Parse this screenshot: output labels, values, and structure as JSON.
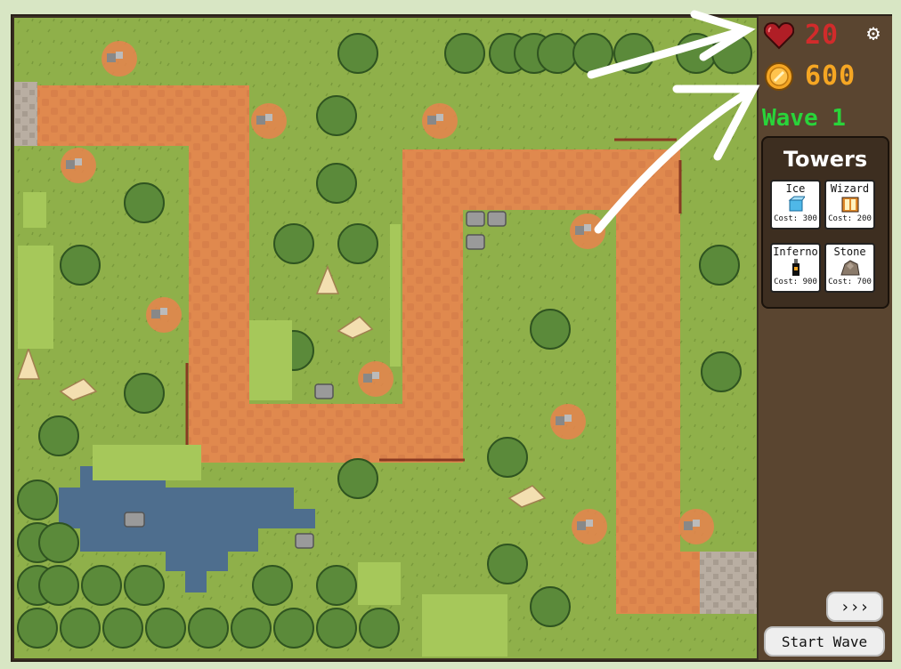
{
  "hud": {
    "lives": "20",
    "gold": "600",
    "wave_label": "Wave 1"
  },
  "towers_panel": {
    "title": "Towers",
    "towers": [
      {
        "name": "Ice",
        "cost": "Cost: 300",
        "icon": "ice-cube-icon"
      },
      {
        "name": "Wizard",
        "cost": "Cost: 200",
        "icon": "spellbook-icon"
      },
      {
        "name": "Inferno",
        "cost": "Cost: 900",
        "icon": "lantern-icon"
      },
      {
        "name": "Stone",
        "cost": "Cost: 700",
        "icon": "rock-icon"
      }
    ]
  },
  "controls": {
    "fast_forward_label": "›››",
    "start_wave_label": "Start Wave"
  },
  "colors": {
    "grass": "#8fb04a",
    "path": "#e0894e",
    "water": "#4e6e8e",
    "panel": "#5a4530",
    "lives": "#d12b2b",
    "gold": "#f5a623",
    "wave": "#29d43a"
  }
}
